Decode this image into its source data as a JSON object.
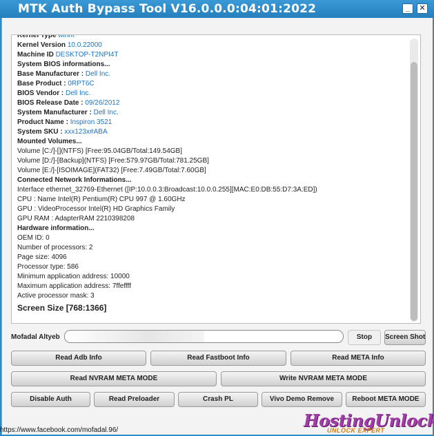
{
  "window": {
    "title": "MTK Auth Bypass Tool V16.0.0.0:04:01:2022",
    "minimize_glyph": "_",
    "close_glyph": "✕"
  },
  "log": [
    {
      "label": "Kernel Type ",
      "value": "winnt",
      "style": "bold"
    },
    {
      "label": "Kernel Version ",
      "value": "10.0.22000",
      "style": "bold"
    },
    {
      "label": "Machine ID ",
      "value": "DESKTOP-T2NPI4T",
      "style": "bold"
    },
    {
      "label": "System BIOS informations...",
      "value": "",
      "style": "bold"
    },
    {
      "label": "Base Manufacturer : ",
      "value": "Dell Inc.",
      "style": "bold"
    },
    {
      "label": "Base Product : ",
      "value": "0RPT6C",
      "style": "bold"
    },
    {
      "label": "BIOS Vendor : ",
      "value": "Dell Inc.",
      "style": "bold"
    },
    {
      "label": "BIOS Release Date : ",
      "value": "09/26/2012",
      "style": "bold"
    },
    {
      "label": "System Manufacturer : ",
      "value": "Dell Inc.",
      "style": "bold"
    },
    {
      "label": "Product Name : ",
      "value": "Inspiron 3521",
      "style": "bold"
    },
    {
      "label": "System SKU : ",
      "value": "xxx123x#ABA",
      "style": "bold"
    },
    {
      "label": "Mounted Volumes...",
      "value": "",
      "style": "bold"
    },
    {
      "label": "Volume [C:/]-[](NTFS) [Free:95.04GB/Total:149.54GB]",
      "value": "",
      "style": "plain"
    },
    {
      "label": "Volume [D:/]-[Backup](NTFS) [Free:579.97GB/Total:781.25GB]",
      "value": "",
      "style": "plain"
    },
    {
      "label": "Volume [E:/]-[ISOIMAGE](FAT32) [Free:7.49GB/Total:7.60GB]",
      "value": "",
      "style": "plain"
    },
    {
      "label": "Connected Network Informations...",
      "value": "",
      "style": "bold"
    },
    {
      "label": "Interface ethernet_32769-Ethernet ([IP:10.0.0.3:Broadcast:10.0.0.255][MAC:E0:DB:55:D7:3A:ED])",
      "value": "",
      "style": "blue"
    },
    {
      "label": "CPU  : Name Intel(R) Pentium(R) CPU 997 @ 1.60GHz",
      "value": "",
      "style": "plain"
    },
    {
      "label": "GPU  : VideoProcessor Intel(R) HD Graphics Family",
      "value": "",
      "style": "plain"
    },
    {
      "label": "GPU RAM  : AdapterRAM 2210398208",
      "value": "",
      "style": "plain"
    },
    {
      "label": "Hardware information...",
      "value": "",
      "style": "bold"
    },
    {
      "label": "OEM ID: 0",
      "value": "",
      "style": "blue"
    },
    {
      "label": "Number of processors: 2",
      "value": "",
      "style": "blue"
    },
    {
      "label": "Page size: 4096",
      "value": "",
      "style": "blue"
    },
    {
      "label": "Processor type: 586",
      "value": "",
      "style": "blue"
    },
    {
      "label": "Minimum application address: 10000",
      "value": "",
      "style": "blue"
    },
    {
      "label": "Maximum application address: 7ffeffff",
      "value": "",
      "style": "blue"
    },
    {
      "label": "Active processor mask: 3",
      "value": "",
      "style": "blue"
    },
    {
      "label": "Screen Size [768:1366]",
      "value": "",
      "style": "big"
    }
  ],
  "owner_label": "Mofadal Altyeb",
  "progress": {
    "fraction": 0.5
  },
  "buttons": {
    "stop": "Stop",
    "screen_shot": "Screen Shot",
    "read_adb_info": "Read Adb Info",
    "read_fastboot_info": "Read Fastboot Info",
    "read_meta_info": "Read META Info",
    "read_nvram_meta_mode": "Read NVRAM META MODE",
    "write_nvram_meta_mode": "Write NVRAM META MODE",
    "disable_auth": "Disable Auth",
    "read_preloader": "Read Preloader",
    "crash_pl": "Crash PL",
    "vivo_demo_remove": "Vivo Demo Remove",
    "reboot_meta_mode": "Reboot META MODE"
  },
  "status_link": "https://www.facebook.com/mofadal.96/",
  "logo": {
    "main": "HostingUnlock",
    "sub": "UNLOCK EXPERT"
  }
}
